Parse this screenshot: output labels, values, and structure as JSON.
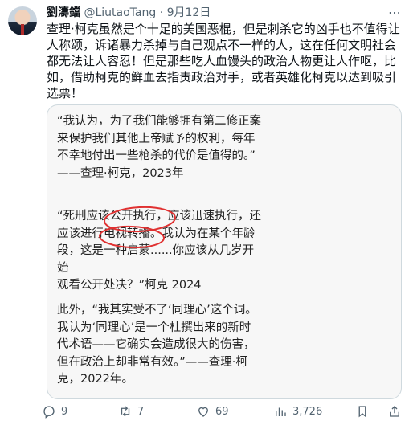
{
  "tweet": {
    "name": "劉濤鐺",
    "handle": "@LiutaoTang",
    "separator": "·",
    "date": "9月12日",
    "text": "查理·柯克虽然是个十足的美国恶棍，但是刺杀它的凶手也不值得让\n人称颂，诉诸暴力杀掉与自己观点不一样的人，这在任何文明社会\n都无法让人容忍！但是那些吃人血馒头的政治人物更让人作呕，比\n如，借助柯克的鲜血去指责政治对手，或者英雄化柯克以达到吸引\n选票！"
  },
  "image": {
    "quote1": "“我认为，为了我们能够拥有第二修正案\n来保护我们其他上帝赋予的权利，每年\n不幸地付出一些枪杀的代价是值得的。”\n——查理·柯克，2023年",
    "quote2": "“死刑应该公开执行，应该迅速执行，还\n应该进行电视转播。我认为在某个年龄\n段，这是一种启蒙......你应该从几岁开始\n观看公开处决？”柯克 2024",
    "quote3": "此外，“我其实受不了‘同理心’这个词。\n我认为‘同理心’是一个杜撰出来的新时\n代术语——它确实会造成很大的伤害，\n但在政治上却非常有效。”——查理·柯\n克，2022年。"
  },
  "actions": {
    "replies": "9",
    "reposts": "7",
    "likes": "69",
    "views": "3,726"
  },
  "colors": {
    "muted": "#536471",
    "annotation": "#e03131"
  }
}
